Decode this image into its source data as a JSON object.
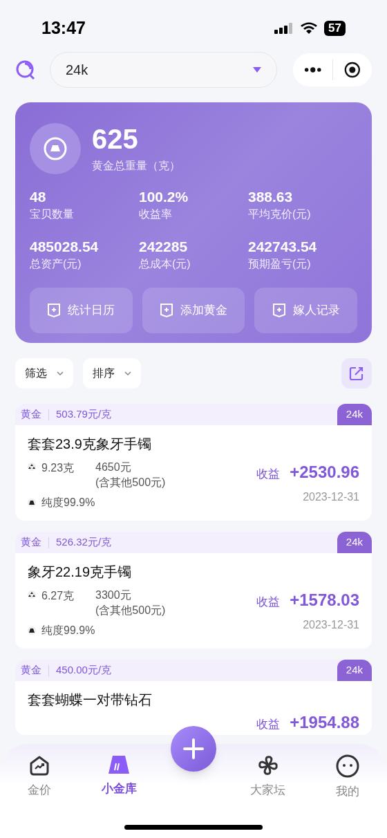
{
  "status_bar": {
    "time": "13:47",
    "battery": "57"
  },
  "header": {
    "selector": {
      "value": "24k"
    }
  },
  "summary": {
    "total_weight": "625",
    "total_weight_label": "黄金总重量（克）",
    "stats": [
      {
        "value": "48",
        "label": "宝贝数量"
      },
      {
        "value": "100.2%",
        "label": "收益率"
      },
      {
        "value": "388.63",
        "label": "平均克价(元)"
      },
      {
        "value": "485028.54",
        "label": "总资产(元)"
      },
      {
        "value": "242285",
        "label": "总成本(元)"
      },
      {
        "value": "242743.54",
        "label": "预期盈亏(元)"
      }
    ],
    "actions": [
      "统计日历",
      "添加黄金",
      "嫁人记录"
    ]
  },
  "filters": [
    "筛选",
    "排序"
  ],
  "items": [
    {
      "category": "黄金",
      "price": "503.79元/克",
      "badge": "24k",
      "title": "套套23.9克象牙手镯",
      "weight": "9.23克",
      "cost": "4650元",
      "other": "(含其他500元)",
      "purity": "纯度99.9%",
      "income_label": "收益",
      "income": "+2530.96",
      "date": "2023-12-31"
    },
    {
      "category": "黄金",
      "price": "526.32元/克",
      "badge": "24k",
      "title": "象牙22.19克手镯",
      "weight": "6.27克",
      "cost": "3300元",
      "other": "(含其他500元)",
      "purity": "纯度99.9%",
      "income_label": "收益",
      "income": "+1578.03",
      "date": "2023-12-31"
    },
    {
      "category": "黄金",
      "price": "450.00元/克",
      "badge": "24k",
      "title": "套套蝴蝶一对带钻石",
      "income_label": "收益",
      "income": "+1954.88"
    }
  ],
  "tab_bar": [
    {
      "kind": "price",
      "label": "金价",
      "selected": false
    },
    {
      "kind": "vault",
      "label": "小金库",
      "selected": true
    },
    {
      "kind": "add"
    },
    {
      "kind": "forum",
      "label": "大家坛",
      "selected": false
    },
    {
      "kind": "me",
      "label": "我的",
      "selected": false
    }
  ]
}
